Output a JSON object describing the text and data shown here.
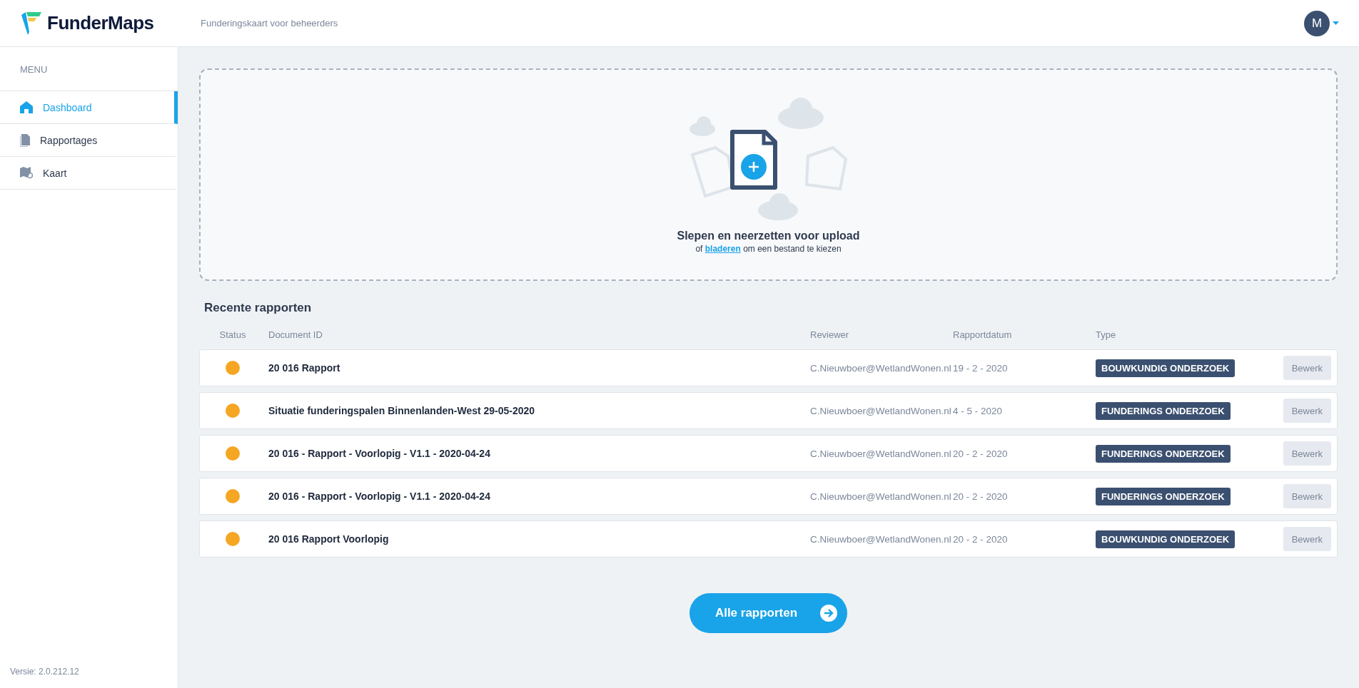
{
  "header": {
    "logo": "FunderMaps",
    "subtitle": "Funderingskaart voor beheerders",
    "avatar": "M"
  },
  "sidebar": {
    "heading": "MENU",
    "items": [
      {
        "label": "Dashboard",
        "selected": true
      },
      {
        "label": "Rapportages",
        "selected": false
      },
      {
        "label": "Kaart",
        "selected": false
      }
    ],
    "version": "Versie: 2.0.212.12"
  },
  "upload": {
    "title": "Slepen en neerzetten voor upload",
    "hint_before": "of",
    "link": "bladeren",
    "hint_after": "om een bestand te kiezen"
  },
  "reports": {
    "title": "Recente rapporten",
    "columns": [
      "Status",
      "Document ID",
      "Reviewer",
      "Rapportdatum",
      "Type"
    ],
    "rows": [
      {
        "color": "#f5a623",
        "document_id": "20 016 Rapport",
        "reviewer": "C.Nieuwboer@WetlandWonen.nl",
        "date": "19 - 2 - 2020",
        "type": "BOUWKUNDIG ONDERZOEK",
        "action": "Bewerk"
      },
      {
        "color": "#f5a623",
        "document_id": "Situatie funderingspalen Binnenlanden-West 29-05-2020",
        "reviewer": "C.Nieuwboer@WetlandWonen.nl",
        "date": "4 - 5 - 2020",
        "type": "FUNDERINGS ONDERZOEK",
        "action": "Bewerk"
      },
      {
        "color": "#f5a623",
        "document_id": "20 016 - Rapport - Voorlopig - V1.1 - 2020-04-24",
        "reviewer": "C.Nieuwboer@WetlandWonen.nl",
        "date": "20 - 2 - 2020",
        "type": "FUNDERINGS ONDERZOEK",
        "action": "Bewerk"
      },
      {
        "color": "#f5a623",
        "document_id": "20 016 - Rapport - Voorlopig - V1.1 - 2020-04-24",
        "reviewer": "C.Nieuwboer@WetlandWonen.nl",
        "date": "20 - 2 - 2020",
        "type": "FUNDERINGS ONDERZOEK",
        "action": "Bewerk"
      },
      {
        "color": "#f5a623",
        "document_id": "20 016 Rapport Voorlopig",
        "reviewer": "C.Nieuwboer@WetlandWonen.nl",
        "date": "20 - 2 - 2020",
        "type": "BOUWKUNDIG ONDERZOEK",
        "action": "Bewerk"
      }
    ],
    "all_button": "Alle rapporten"
  }
}
